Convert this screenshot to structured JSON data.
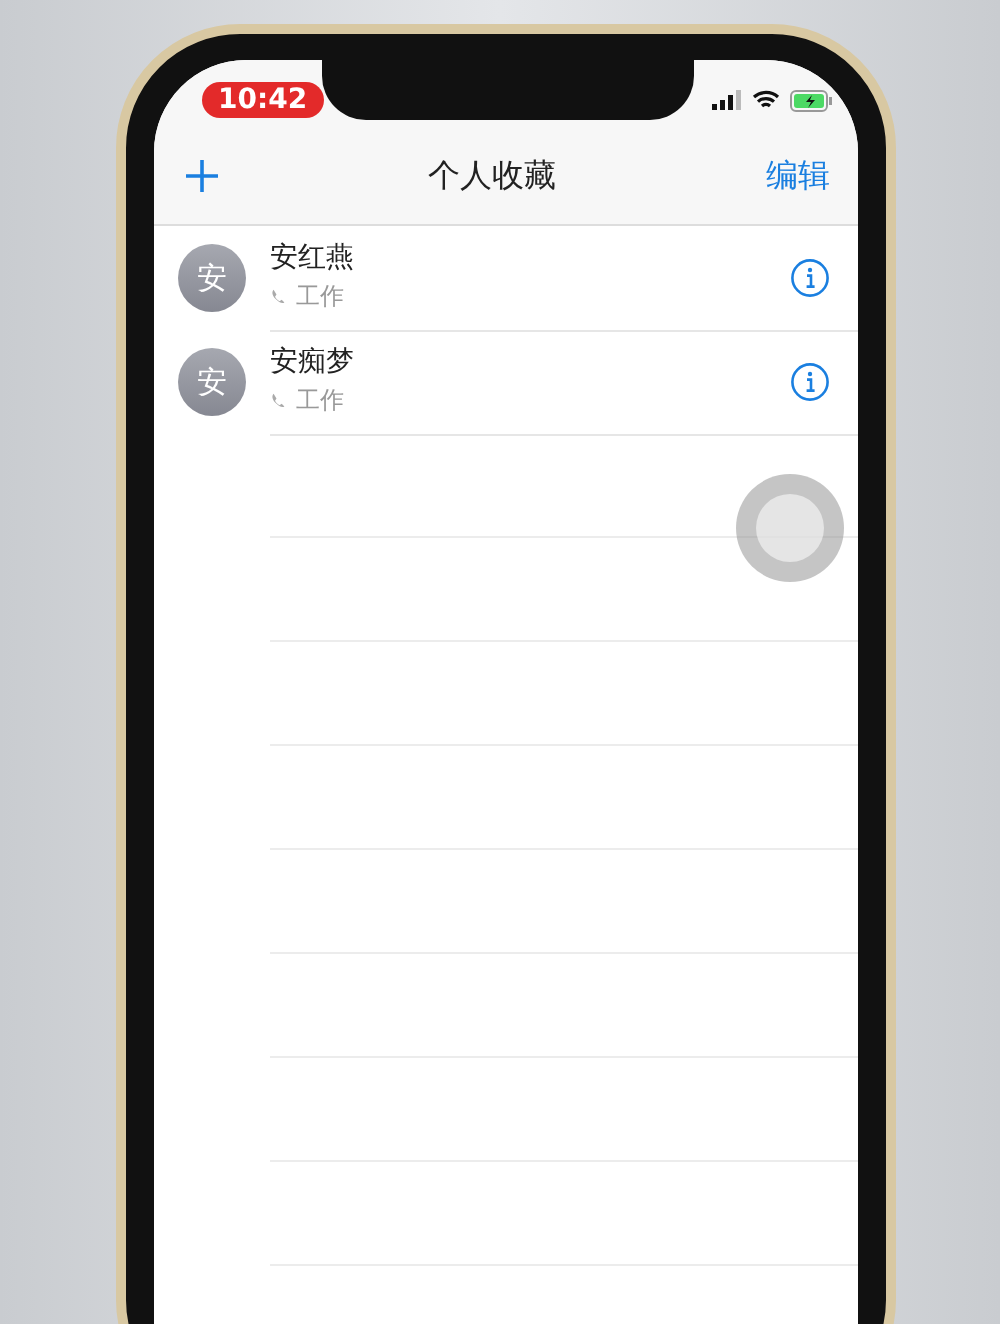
{
  "status_bar": {
    "time": "10:42"
  },
  "nav_bar": {
    "title": "个人收藏",
    "edit": "编辑"
  },
  "favorites": [
    {
      "avatar": "安",
      "name": "安红燕",
      "label": "工作"
    },
    {
      "avatar": "安",
      "name": "安痴梦",
      "label": "工作"
    }
  ]
}
